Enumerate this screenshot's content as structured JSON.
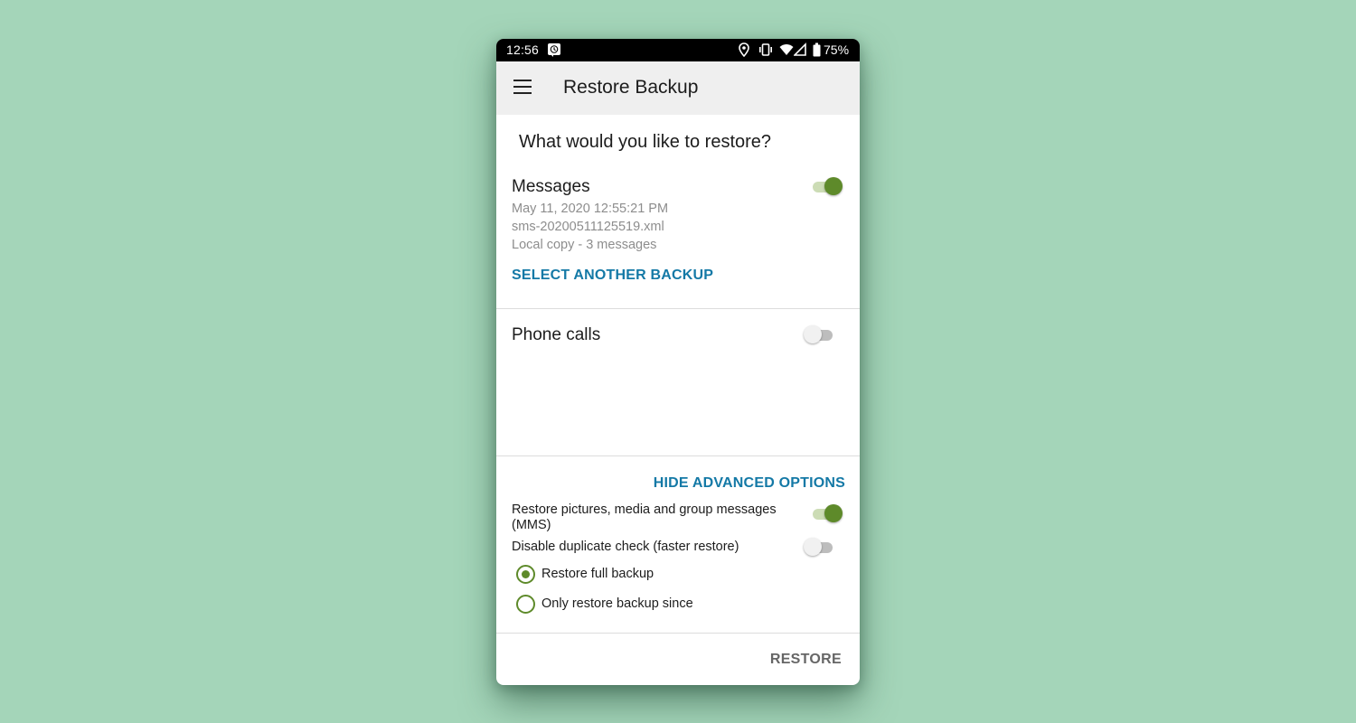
{
  "status_bar": {
    "time": "12:56",
    "notification_icon": "alarm-clock-icon",
    "icons": [
      "location-icon",
      "vibrate-icon",
      "wifi-icon",
      "signal-icon",
      "battery-icon"
    ],
    "battery": "75%"
  },
  "app_bar": {
    "menu_icon": "hamburger-menu-icon",
    "title": "Restore Backup"
  },
  "main": {
    "question": "What would you like to restore?",
    "messages": {
      "title": "Messages",
      "enabled": true,
      "date": "May 11, 2020 12:55:21 PM",
      "file": "sms-20200511125519.xml",
      "summary": "Local copy - 3 messages",
      "select_label": "SELECT ANOTHER BACKUP"
    },
    "phone_calls": {
      "title": "Phone calls",
      "enabled": false
    }
  },
  "advanced": {
    "toggle_label": "HIDE ADVANCED OPTIONS",
    "options": [
      {
        "label_line1": "Restore pictures, media and group messages",
        "label_line2": "(MMS)",
        "enabled": true
      },
      {
        "label": "Disable duplicate check (faster restore)",
        "enabled": false
      }
    ],
    "restore_mode": {
      "options": [
        "Restore full backup",
        "Only restore backup since"
      ],
      "selected": "Restore full backup"
    }
  },
  "footer": {
    "restore_label": "RESTORE"
  },
  "colors": {
    "background": "#a4d5b9",
    "accent_green": "#5e8a2a",
    "link_blue": "#1479a6",
    "app_bar": "#efefef"
  }
}
